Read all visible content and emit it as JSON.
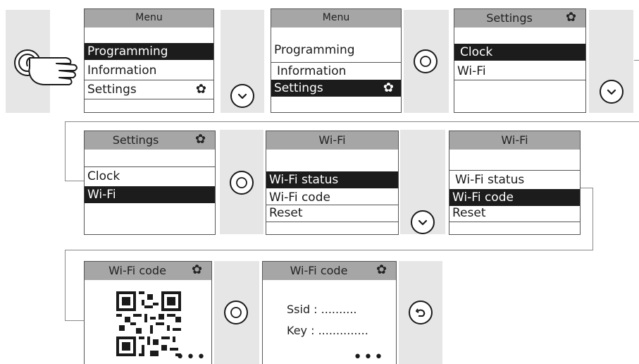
{
  "gear_glyph": "✿",
  "step1": {
    "title": "Menu",
    "items": [
      "Programming",
      "Information",
      "Settings"
    ]
  },
  "step2": {
    "title": "Menu",
    "items": [
      "Programming",
      "Information",
      "Settings"
    ]
  },
  "step3": {
    "title": "Settings",
    "items": [
      "Clock",
      "Wi-Fi"
    ]
  },
  "step4": {
    "title": "Settings",
    "items": [
      "Clock",
      "Wi-Fi"
    ]
  },
  "step5": {
    "title": "Wi-Fi",
    "items": [
      "Wi-Fi status",
      "Wi-Fi code",
      "Reset"
    ]
  },
  "step6": {
    "title": "Wi-Fi",
    "items": [
      "Wi-Fi status",
      "Wi-Fi code",
      "Reset"
    ]
  },
  "step7": {
    "title": "Wi-Fi code",
    "ellipsis": "•••"
  },
  "step8": {
    "title": "Wi-Fi code",
    "ssid": "Ssid : ..........",
    "key": "Key : ..............",
    "ellipsis": "•••"
  },
  "buttons": {
    "press": "press-button",
    "down": "chevron-down",
    "ok": "ok-circle",
    "back": "back-arrow"
  },
  "colors": {
    "header": "#a6a6a6",
    "selected": "#1c1c1c",
    "band": "#e6e6e6",
    "connector": "#888888"
  }
}
